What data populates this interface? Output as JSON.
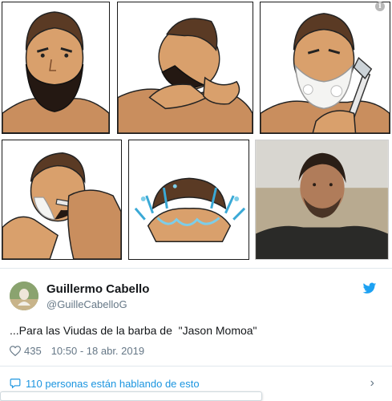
{
  "media": {
    "panels": [
      {
        "name": "panel-bearded-man"
      },
      {
        "name": "panel-applying-foam"
      },
      {
        "name": "panel-foam-and-razor"
      },
      {
        "name": "panel-shaving"
      },
      {
        "name": "panel-rinsing-face"
      },
      {
        "name": "panel-jason-momoa-photo"
      }
    ]
  },
  "tweet": {
    "author_name": "Guillermo Cabello",
    "author_handle": "@GuilleCabelloG",
    "text": "...Para las Viudas de la barba de  \"Jason Momoa\"",
    "likes": "435",
    "timestamp": "10:50 - 18 abr. 2019",
    "talking_label": "110 personas están hablando de esto"
  },
  "colors": {
    "accent": "#1b95e0",
    "muted_text": "#657786",
    "text": "#14171a"
  },
  "icons": [
    "info-icon",
    "twitter-bird-icon",
    "heart-icon",
    "speech-bubble-icon",
    "chevron-right-icon"
  ]
}
